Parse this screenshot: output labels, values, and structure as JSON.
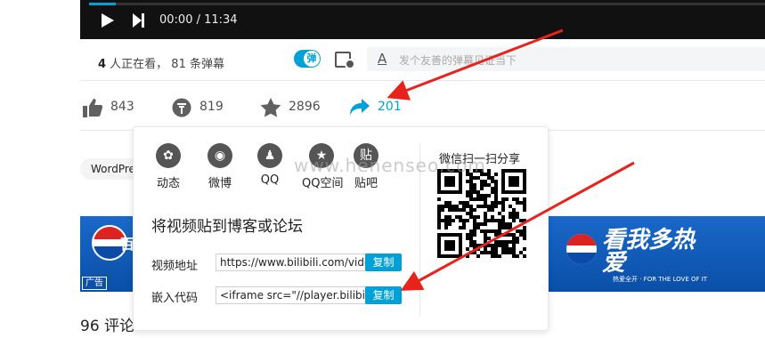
{
  "player": {
    "time": "00:00 / 11:34"
  },
  "danmaku_bar": {
    "online_count": "4",
    "online_text": " 人正在看， 81 条弹幕",
    "toggle_label": "弹",
    "input_placeholder": "发个友善的弹幕见证当下"
  },
  "actions": {
    "like": "843",
    "coin": "819",
    "favorite": "2896",
    "share": "201"
  },
  "tag": "WordPre",
  "banner": {
    "left_text": "百",
    "slogan": "看我多热爱",
    "slogan_sub": "热爱全开 · FOR THE LOVE OF IT",
    "ad_label": "广告"
  },
  "comments": "96  评论",
  "share_popup": {
    "sns": [
      {
        "label": "动态",
        "glyph": "✿"
      },
      {
        "label": "微博",
        "glyph": "◉"
      },
      {
        "label": "QQ",
        "glyph": "♟"
      },
      {
        "label": "QQ空间",
        "glyph": "★"
      },
      {
        "label": "贴吧",
        "glyph": "贴"
      }
    ],
    "embed_title": "将视频贴到博客或论坛",
    "video_url_label": "视频地址",
    "video_url": "https://www.bilibili.com/video/",
    "embed_code_label": "嵌入代码",
    "embed_code": "<iframe src=\"//player.bilibili.co",
    "copy_label": "复制",
    "wechat_title": "微信扫一扫分享"
  },
  "watermark": "www.henenseo.com",
  "colors": {
    "accent": "#00a1d6",
    "arrow": "#e8231e"
  }
}
